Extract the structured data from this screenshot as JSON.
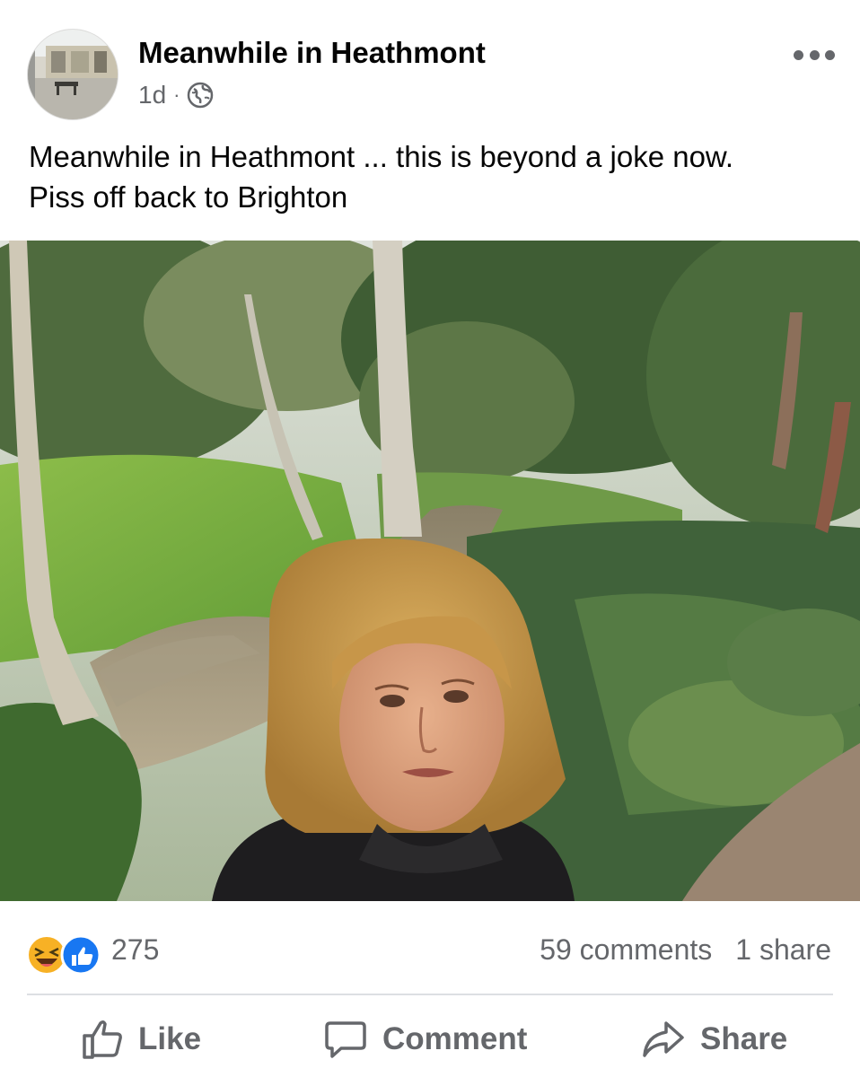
{
  "post": {
    "page_name": "Meanwhile in Heathmont",
    "timestamp": "1d",
    "separator": "·",
    "audience_icon": "globe-icon",
    "more_icon": "more-horizontal-icon",
    "text_line1": "Meanwhile in Heathmont ... this is beyond a joke now.",
    "text_line2": "Piss off back to Brighton"
  },
  "photo": {
    "description_icon": "photo"
  },
  "reactions": {
    "icons": [
      "haha-icon",
      "like-icon"
    ],
    "count": "275",
    "comments": "59 comments",
    "shares": "1 share"
  },
  "actions": {
    "like": "Like",
    "comment": "Comment",
    "share": "Share"
  },
  "colors": {
    "secondary_text": "#65676b",
    "like_blue": "#1877f2",
    "haha_yellow": "#f7b125"
  }
}
